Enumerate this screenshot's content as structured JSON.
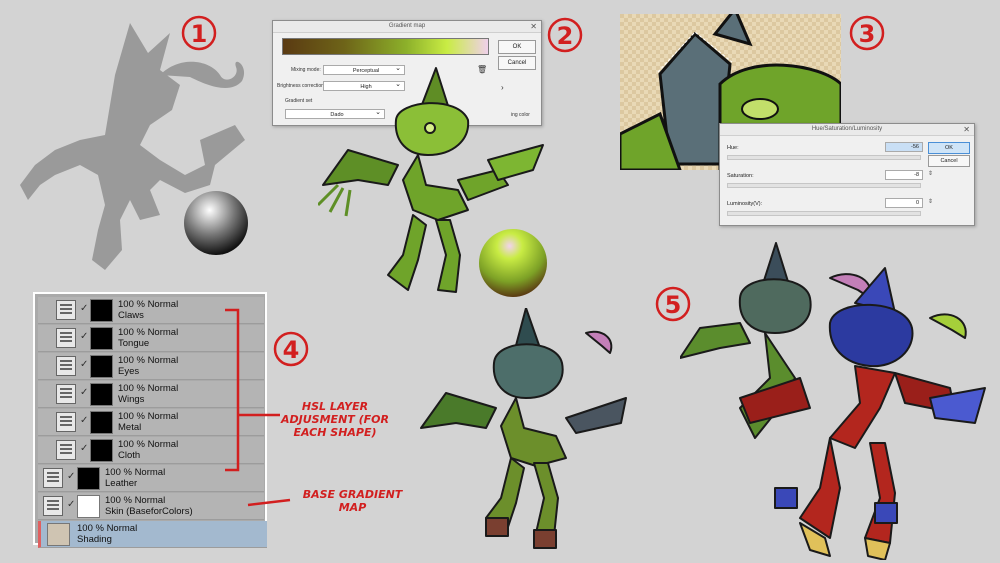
{
  "steps": [
    "1",
    "2",
    "3",
    "4",
    "5"
  ],
  "gradient_map": {
    "title": "Gradient map",
    "ok": "OK",
    "cancel": "Cancel",
    "mixing_label": "Mixing mode:",
    "mixing_value": "Perceptual",
    "brightness_label": "Brightness correction:",
    "brightness_value": "High",
    "gradient_set_label": "Gradient set",
    "gradient_set_value": "Dado",
    "color_label": "ing color"
  },
  "hsl": {
    "title": "Hue/Saturation/Luminosity",
    "hue_label": "Hue:",
    "hue_value": "-56",
    "saturation_label": "Saturation:",
    "saturation_value": "-8",
    "luminosity_label": "Luminosity(V):",
    "luminosity_value": "0",
    "ok": "OK",
    "cancel": "Cancel"
  },
  "layers": [
    {
      "blend": "100 % Normal",
      "name": "Claws",
      "type": "mask",
      "selected": false
    },
    {
      "blend": "100 % Normal",
      "name": "Tongue",
      "type": "mask",
      "selected": false
    },
    {
      "blend": "100 % Normal",
      "name": "Eyes",
      "type": "mask",
      "selected": false
    },
    {
      "blend": "100 % Normal",
      "name": "Wings",
      "type": "mask",
      "selected": false
    },
    {
      "blend": "100 % Normal",
      "name": "Metal",
      "type": "mask",
      "selected": false
    },
    {
      "blend": "100 % Normal",
      "name": "Cloth",
      "type": "mask",
      "selected": false
    },
    {
      "blend": "100 % Normal",
      "name": "Leather",
      "type": "mask",
      "selected": false
    },
    {
      "blend": "100 % Normal",
      "name": "Skin (BaseforColors)",
      "type": "gradient",
      "selected": false
    },
    {
      "blend": "100 % Normal",
      "name": "Shading",
      "type": "raster",
      "selected": true
    }
  ],
  "notes": {
    "hsl": "HSL LAYER ADJUSMENT (FOR EACH SHAPE)",
    "base": "BASE GRADIENT MAP"
  },
  "colors": {
    "annotation": "#d21f1f",
    "panel_bg": "#d3d3d3",
    "goblin_green": "#6fa42a",
    "goblin_red": "#b3261e",
    "helmet_blue": "#3a48b8"
  }
}
